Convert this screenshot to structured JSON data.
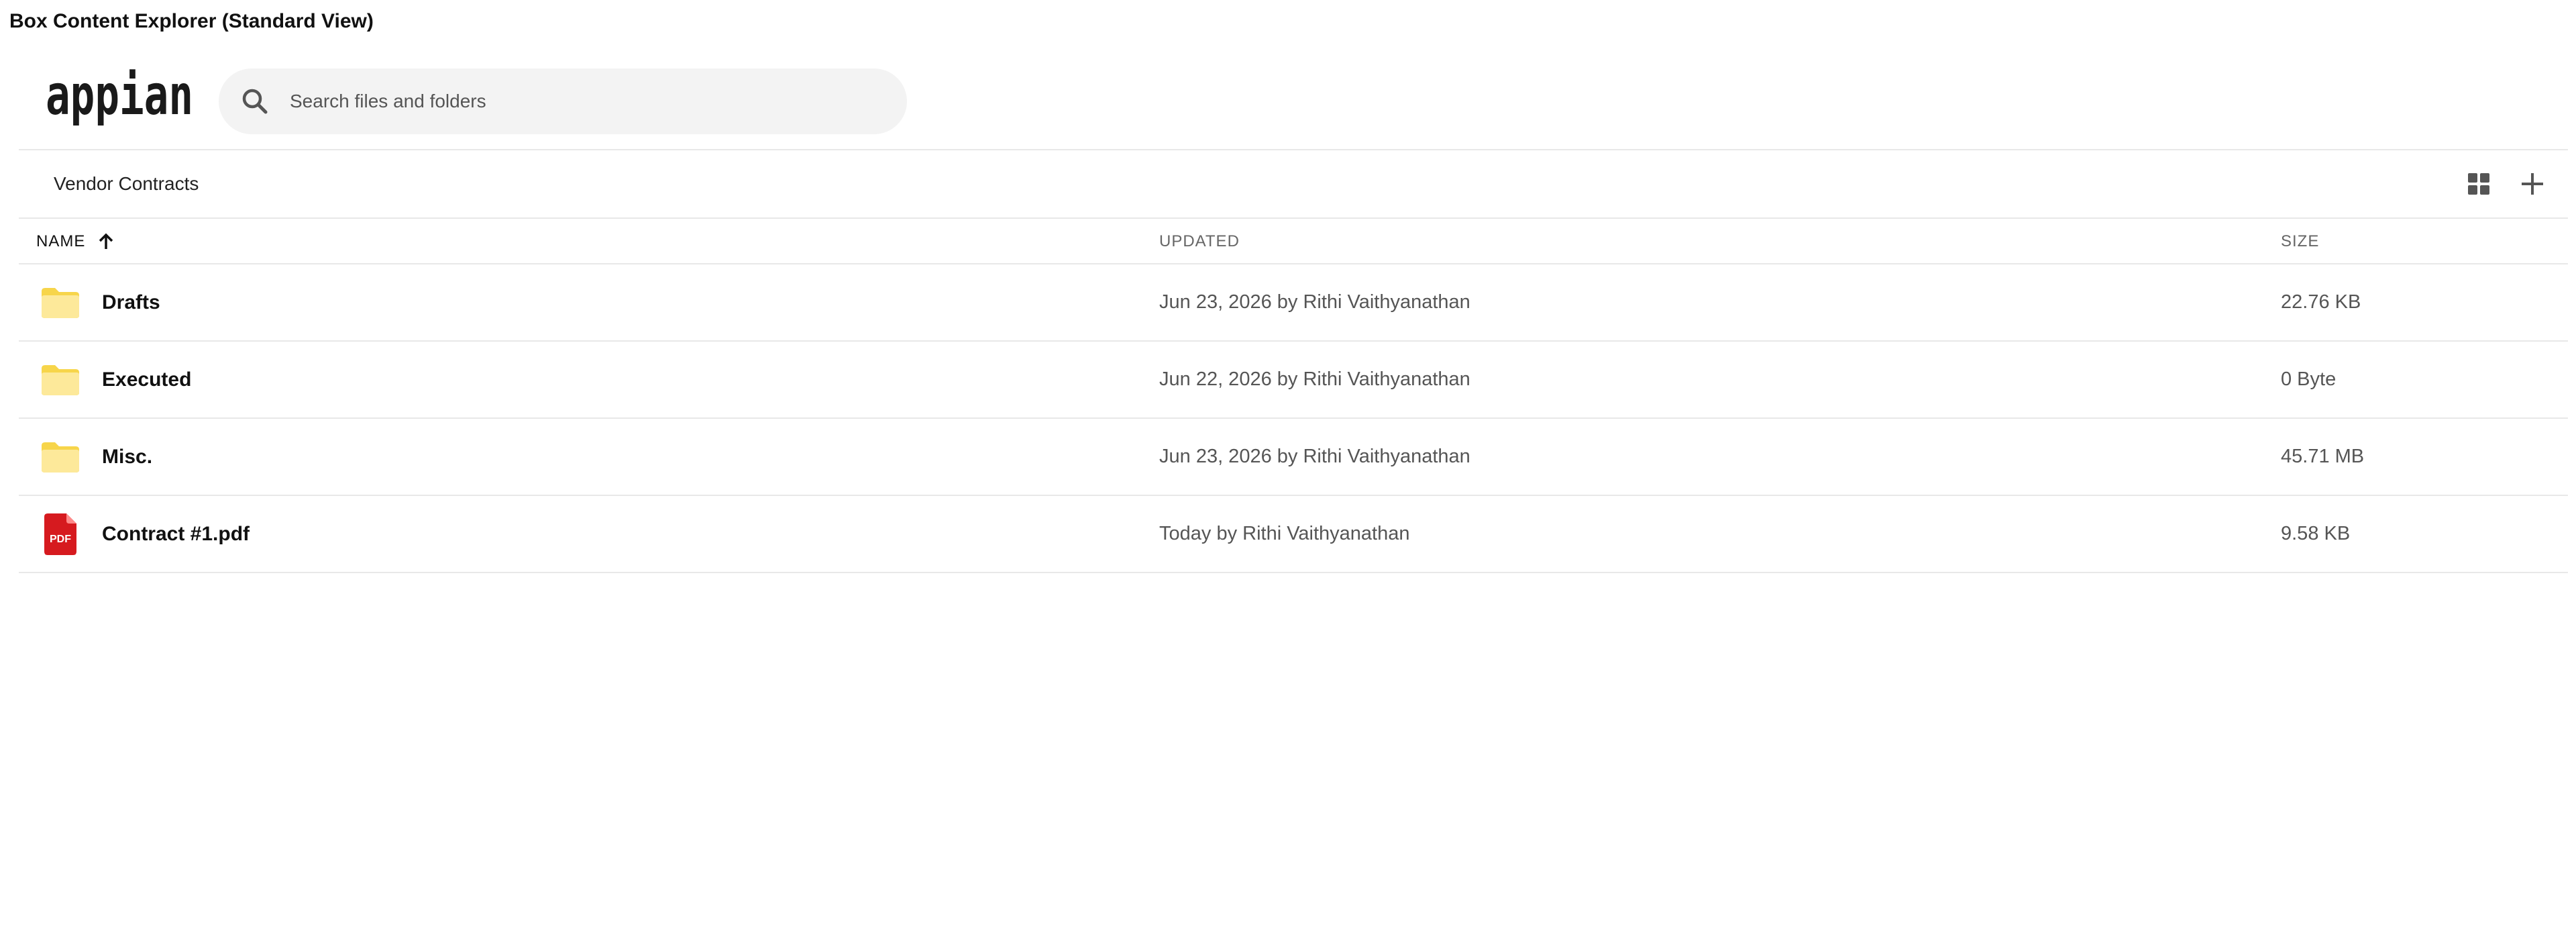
{
  "window": {
    "title": "Box Content Explorer (Standard View)"
  },
  "brand": {
    "logo_text": "appian",
    "folder_color": "#f7d54a",
    "folder_color_light": "#fde99a",
    "pdf_color": "#d61a1f"
  },
  "search": {
    "placeholder": "Search files and folders",
    "value": ""
  },
  "breadcrumb": {
    "current": "Vendor Contracts"
  },
  "toolbar": {
    "grid_view_icon": "grid-icon",
    "add_icon": "plus-icon"
  },
  "table": {
    "columns": {
      "name": "NAME",
      "updated": "UPDATED",
      "size": "SIZE"
    },
    "sort": "ascending",
    "rows": [
      {
        "type": "folder",
        "icon": "folder-icon",
        "name": "Drafts",
        "updated": "Jun 23, 2026 by Rithi Vaithyanathan",
        "size": "22.76 KB"
      },
      {
        "type": "folder",
        "icon": "folder-icon",
        "name": "Executed",
        "updated": "Jun 22, 2026 by Rithi Vaithyanathan",
        "size": "0 Byte"
      },
      {
        "type": "folder",
        "icon": "folder-icon",
        "name": "Misc.",
        "updated": "Jun 23, 2026 by Rithi Vaithyanathan",
        "size": "45.71 MB"
      },
      {
        "type": "pdf",
        "icon": "pdf-file-icon",
        "icon_label": "PDF",
        "name": "Contract #1.pdf",
        "updated": "Today by Rithi Vaithyanathan",
        "size": "9.58 KB"
      }
    ]
  }
}
